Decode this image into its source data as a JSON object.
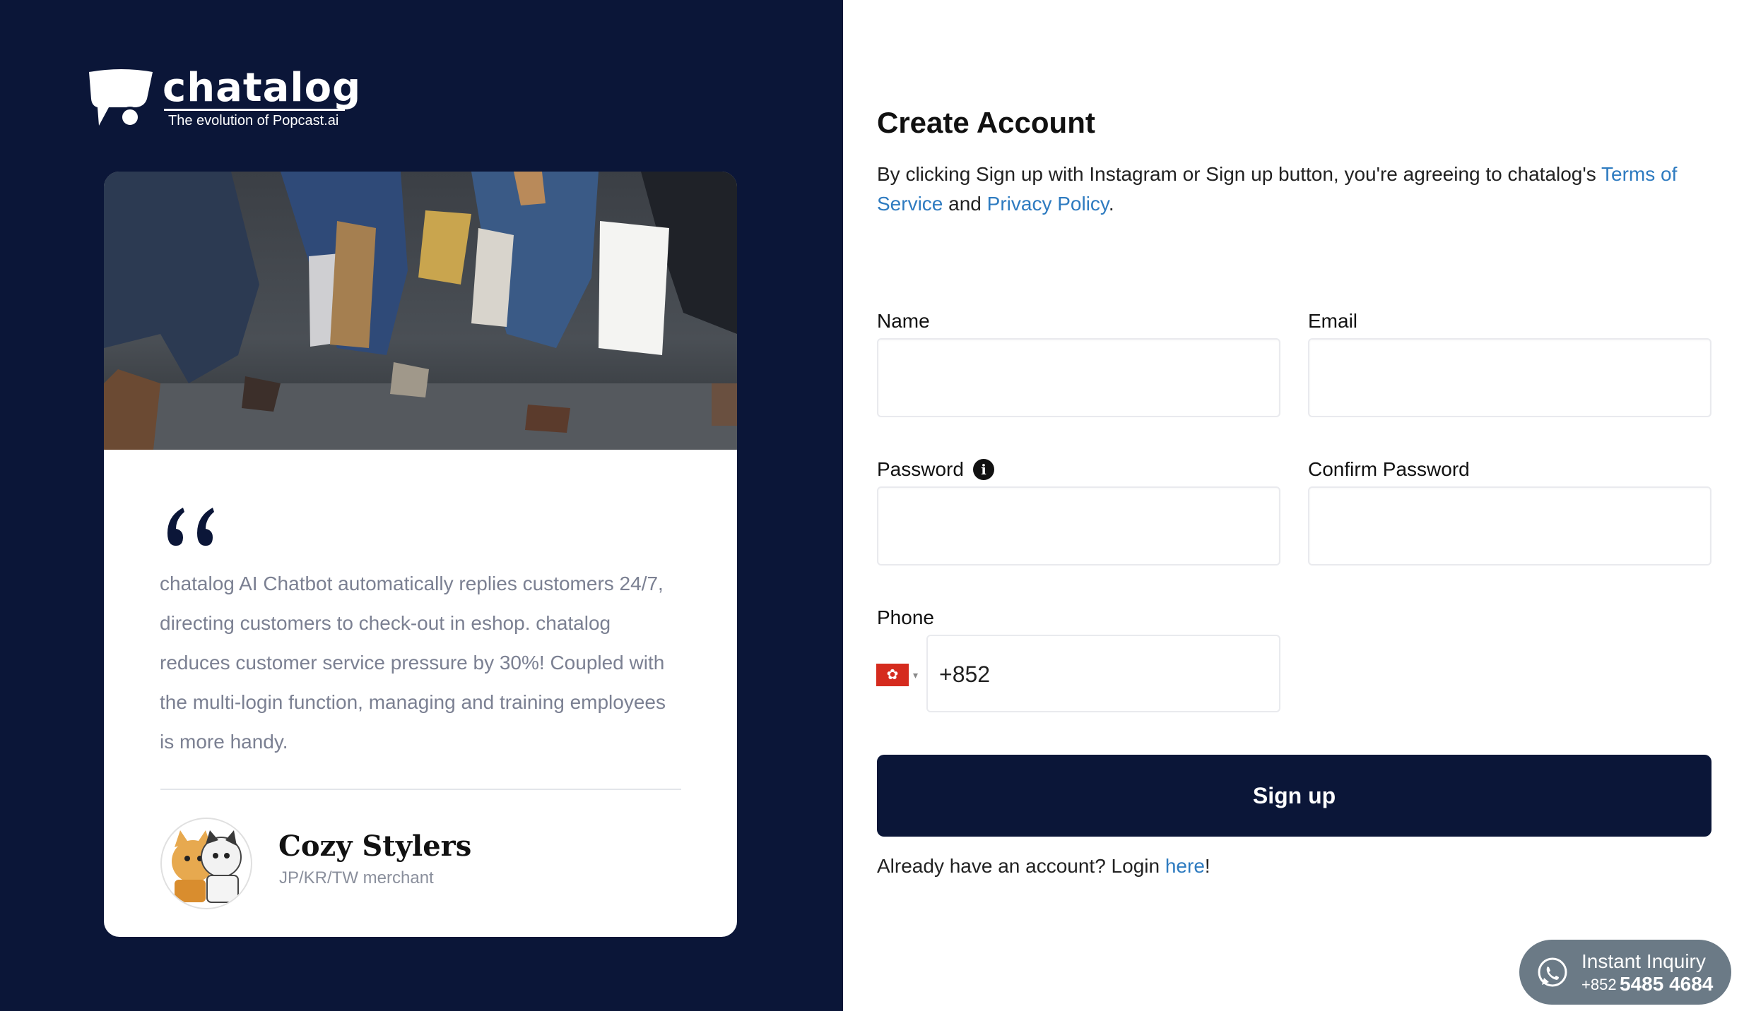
{
  "brand": {
    "name": "chatalog",
    "tagline": "The evolution of Popcast.ai"
  },
  "testimonial": {
    "quote": "chatalog AI Chatbot automatically replies customers 24/7, directing customers to check-out in eshop. chatalog reduces customer service pressure by 30%! Coupled with the multi-login function, managing and training employees is more handy.",
    "merchant_name": "Cozy Stylers",
    "merchant_role": "JP/KR/TW merchant",
    "icons": {
      "quote": "quote-mark-icon",
      "avatar": "merchant-avatar"
    }
  },
  "form": {
    "title": "Create Account",
    "agreement": {
      "prefix": "By clicking Sign up with Instagram or Sign up button, you're agreeing to chatalog's ",
      "terms_link": "Terms of Service",
      "middle": " and ",
      "privacy_link": "Privacy Policy",
      "suffix": "."
    },
    "name_label": "Name",
    "name_value": "",
    "email_label": "Email",
    "email_value": "",
    "password_label": "Password",
    "password_value": "",
    "confirm_password_label": "Confirm Password",
    "confirm_password_value": "",
    "phone_label": "Phone",
    "phone_country": "HK",
    "phone_value": "+852",
    "signup_label": "Sign up",
    "login": {
      "prefix": "Already have an account? Login ",
      "link": "here",
      "suffix": "!"
    }
  },
  "inquiry": {
    "title": "Instant Inquiry",
    "prefix": "+852",
    "number": "5485 4684",
    "icon": "whatsapp-icon"
  },
  "colors": {
    "navy": "#0b1638",
    "link": "#2e7bc0",
    "quote_text": "#7b8092",
    "inquiry_bg": "#6b7a86",
    "flag_red": "#d52b1e"
  }
}
